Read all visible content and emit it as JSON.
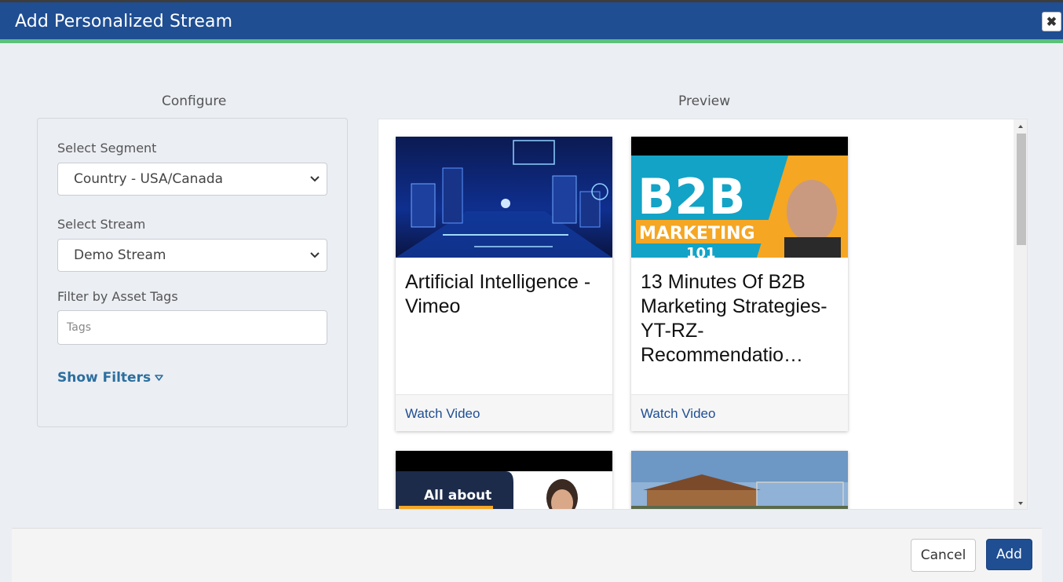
{
  "dialog": {
    "title": "Add Personalized Stream",
    "close_icon": "close-icon"
  },
  "configure": {
    "heading": "Configure",
    "segment_label": "Select Segment",
    "segment_value": "Country - USA/Canada",
    "stream_label": "Select Stream",
    "stream_value": "Demo Stream",
    "tags_label": "Filter by Asset Tags",
    "tags_placeholder": "Tags",
    "show_filters": "Show Filters"
  },
  "preview": {
    "heading": "Preview",
    "cards": [
      {
        "title": "Artificial Intelligence - Vimeo",
        "action": "Watch Video"
      },
      {
        "title": "13 Minutes Of B2B Marketing Strategies-YT-RZ-Recommendatio…",
        "action": "Watch Video",
        "thumb_text_1": "B2B",
        "thumb_text_2": "MARKETING",
        "thumb_text_3": "101"
      },
      {
        "thumb_text": "All about"
      },
      {}
    ]
  },
  "footer": {
    "cancel": "Cancel",
    "add": "Add"
  },
  "colors": {
    "header": "#1f4e92",
    "accent_stripe": "#5cc27a",
    "link": "#2b6f9f"
  }
}
